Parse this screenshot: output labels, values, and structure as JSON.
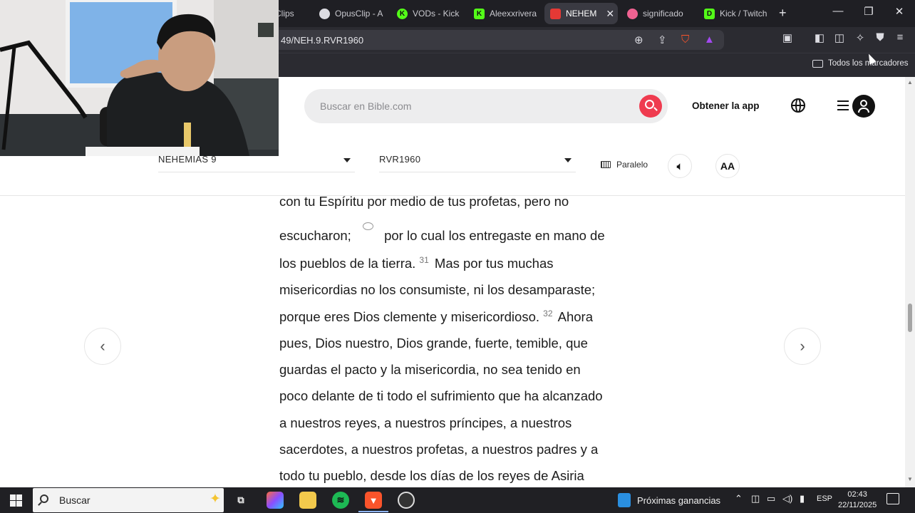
{
  "browser": {
    "tabs": [
      {
        "label": "Clips",
        "active": false,
        "icon": "clips-icon"
      },
      {
        "label": "OpusClip - A",
        "active": false,
        "icon": "opusclip-icon"
      },
      {
        "label": "VODs - Kick",
        "active": false,
        "icon": "kick-icon"
      },
      {
        "label": "Aleexxrivera",
        "active": false,
        "icon": "kick-icon"
      },
      {
        "label": "NEHEM",
        "active": true,
        "icon": "bible-icon"
      },
      {
        "label": "significado",
        "active": false,
        "icon": "brave-icon"
      },
      {
        "label": "Kick / Twitch",
        "active": false,
        "icon": "kick-icon"
      }
    ],
    "url": "49/NEH.9.RVR1960",
    "bookmarks_folder": "Todos los marcadores",
    "shield_badge": "4",
    "rewards_badge": "1"
  },
  "site": {
    "search_placeholder": "Buscar en Bible.com",
    "get_app": "Obtener la app",
    "book_selector": "NEHEMÍAS 9",
    "version_selector": "RVR1960",
    "parallel_label": "Paralelo",
    "font_size_label": "AA"
  },
  "passage": {
    "lines": [
      {
        "pre": "con tu Espíritu por medio de tus profetas, pero no",
        "verse": "",
        "post": ""
      },
      {
        "pre": "escucharon;",
        "verse": "",
        "post": "por lo cual los entregaste en mano de"
      },
      {
        "pre": "los pueblos de la tierra.",
        "verse": "31",
        "post": "Mas por tus muchas"
      },
      {
        "pre": "misericordias no los consumiste, ni los desamparaste;",
        "verse": "",
        "post": ""
      },
      {
        "pre": "porque eres Dios clemente y misericordioso.",
        "verse": "32",
        "post": "Ahora"
      },
      {
        "pre": "pues, Dios nuestro, Dios grande, fuerte, temible, que",
        "verse": "",
        "post": ""
      },
      {
        "pre": "guardas el pacto y la misericordia, no sea tenido en",
        "verse": "",
        "post": ""
      },
      {
        "pre": "poco delante de ti todo el sufrimiento que ha alcanzado",
        "verse": "",
        "post": ""
      },
      {
        "pre": "a nuestros reyes, a nuestros príncipes, a nuestros",
        "verse": "",
        "post": ""
      },
      {
        "pre": "sacerdotes, a nuestros profetas, a nuestros padres y a",
        "verse": "",
        "post": ""
      },
      {
        "pre": "todo tu pueblo, desde los días de los reyes de Asiria",
        "verse": "",
        "post": ""
      }
    ]
  },
  "taskbar": {
    "search_label": "Buscar",
    "widget_label": "Próximas ganancias",
    "language": "ESP",
    "time": "02:43",
    "date": "22/11/2025"
  }
}
